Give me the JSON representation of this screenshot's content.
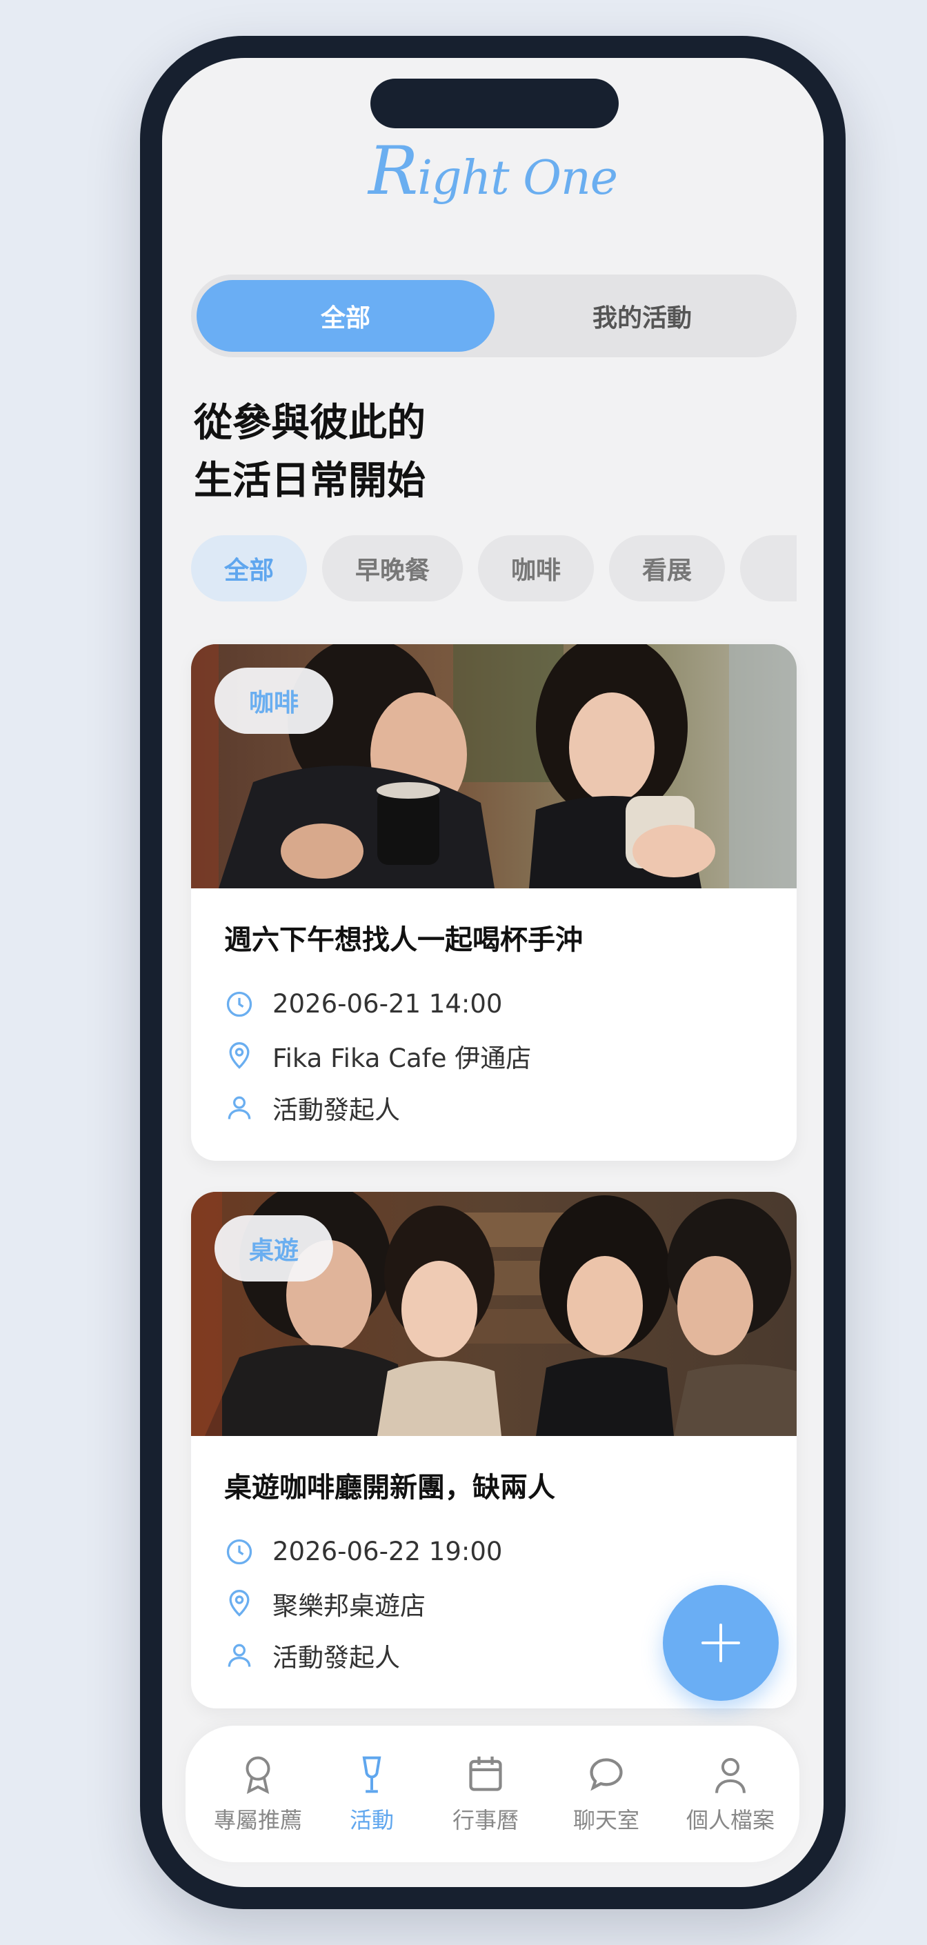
{
  "app": {
    "logo_text_cap": "R",
    "logo_text_rest": "ight One"
  },
  "segment": {
    "all_label": "全部",
    "mine_label": "我的活動"
  },
  "headline": {
    "line1": "從參與彼此的",
    "line2": "生活日常開始"
  },
  "categories": [
    "全部",
    "早晚餐",
    "咖啡",
    "看展",
    ""
  ],
  "events": [
    {
      "tag": "咖啡",
      "title": "週六下午想找人一起喝杯手沖",
      "datetime": "2026-06-21 14:00",
      "location": "Fika Fika Cafe 伊通店",
      "organizer": "活動發起人"
    },
    {
      "tag": "桌遊",
      "title": "桌遊咖啡廳開新團，缺兩人",
      "datetime": "2026-06-22 19:00",
      "location": "聚樂邦桌遊店",
      "organizer": "活動發起人"
    }
  ],
  "nav": [
    {
      "label": "專屬推薦",
      "icon": "award-icon"
    },
    {
      "label": "活動",
      "icon": "glass-icon"
    },
    {
      "label": "行事曆",
      "icon": "calendar-icon"
    },
    {
      "label": "聊天室",
      "icon": "chat-icon"
    },
    {
      "label": "個人檔案",
      "icon": "user-icon"
    }
  ],
  "colors": {
    "accent": "#6aaef4",
    "frame": "#17202f",
    "background": "#f2f2f3"
  }
}
